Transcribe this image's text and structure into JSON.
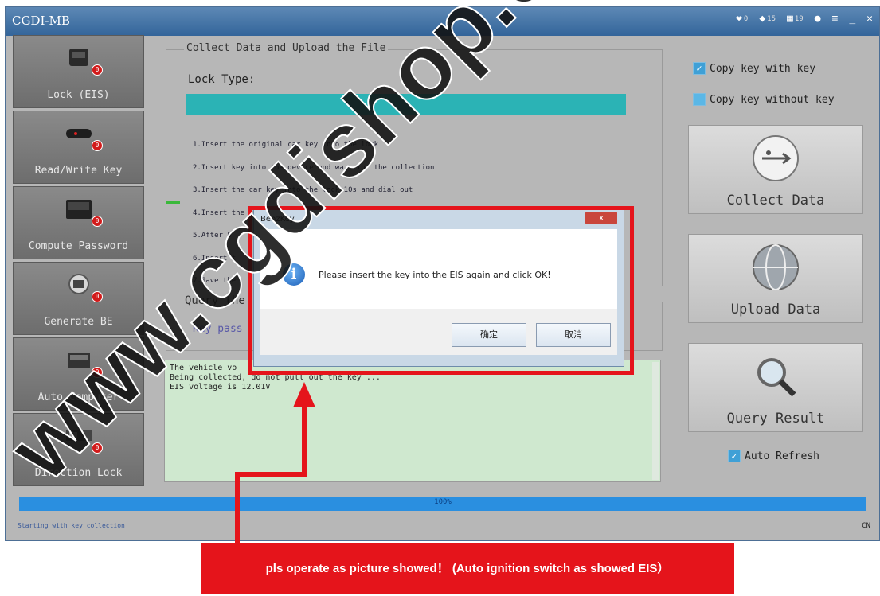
{
  "window": {
    "title": "CGDI-MB",
    "tb_counts": [
      "0",
      "15",
      "19"
    ]
  },
  "sidebar": {
    "items": [
      {
        "label": "Lock (EIS)",
        "badge": "0"
      },
      {
        "label": "Read/Write Key",
        "badge": "0"
      },
      {
        "label": "Compute Password",
        "badge": "0"
      },
      {
        "label": "Generate BE",
        "badge": "0"
      },
      {
        "label": "Auto Computer",
        "badge": "0"
      },
      {
        "label": "Direction Lock",
        "badge": "0"
      }
    ]
  },
  "collect": {
    "legend": "Collect Data and Upload the File",
    "lock_type_label": "Lock Type:",
    "steps": [
      "1.Insert  the  original  car  key  into  the  lock",
      "2.Insert  key  into  the  device  and  wait  for  the  collection",
      "3.Insert  the  car  key  into  the  lock  10s  and  dial  out",
      "4.Insert  the  key  into  the  EIS",
      "5.After  5",
      "6.Insert  t",
      "7.Save  the"
    ]
  },
  "query": {
    "legend": "Query the",
    "key_pass": "Key pass"
  },
  "log": {
    "lines": [
      "The vehicle vo",
      "Being collected,  do  not  pull  out  the  key ...",
      "EIS voltage is 12.01V"
    ]
  },
  "right": {
    "copy_with_key": "Copy key with key",
    "copy_without_key": "Copy key without key",
    "collect_data": "Collect Data",
    "upload_data": "Upload  Data",
    "query_result": "Query Result",
    "auto_refresh": "Auto Refresh"
  },
  "progress": {
    "label": "100%",
    "value": 1.0
  },
  "status": {
    "text": "Starting with key collection",
    "lang": "CN"
  },
  "dialog": {
    "title": "BenzKey",
    "close": "x",
    "message": "Please insert the key into the EIS again and click OK!",
    "ok": "确定",
    "cancel": "取消"
  },
  "banner": {
    "text": "pls operate as picture showed！ (Auto ignition switch as showed EIS）"
  },
  "watermark": {
    "text": "www.cgdishop.com"
  },
  "colors": {
    "accent": "#2a8fe0",
    "teal": "#2bb3b5",
    "highlight": "#e5141b",
    "log_bg": "#cfe8cf"
  }
}
